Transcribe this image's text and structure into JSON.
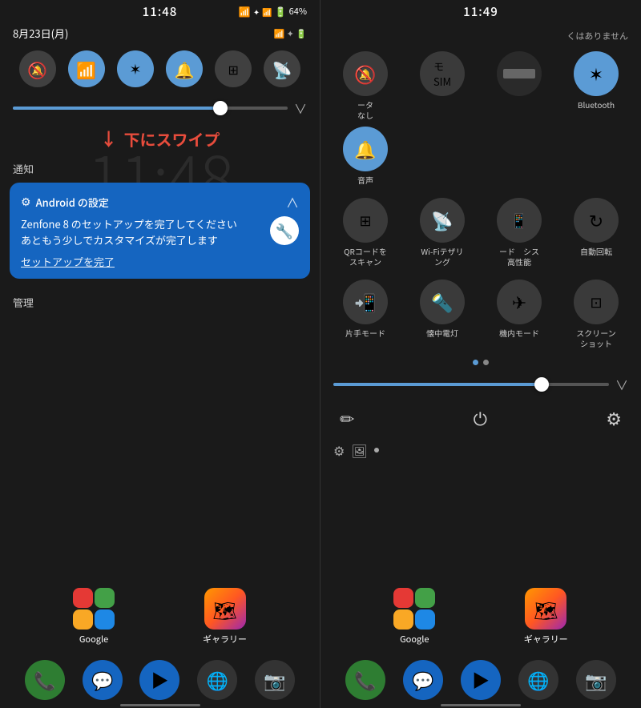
{
  "left_panel": {
    "status_time": "11:48",
    "date": "8月23日(月)",
    "battery": "64%",
    "toggles": [
      {
        "id": "silent",
        "icon": "🔕",
        "active": false
      },
      {
        "id": "wifi",
        "icon": "📶",
        "active": true
      },
      {
        "id": "bluetooth",
        "icon": "🔵",
        "active": true
      },
      {
        "id": "bell",
        "icon": "🔔",
        "active": true
      },
      {
        "id": "qr",
        "icon": "⊞",
        "active": false
      },
      {
        "id": "cast",
        "icon": "📡",
        "active": false
      }
    ],
    "swipe_text": "下にスワイプ",
    "clock_bg": "11:48",
    "notification_label": "通知",
    "notification": {
      "app_name": "Android の設定",
      "title": "Zenfone 8 のセットアップを完了してください\nあともう少しでカスタマイズが完了します",
      "action": "セットアップを完了"
    },
    "management_label": "管理",
    "app_groups": [
      {
        "label": "Google"
      },
      {
        "label": "ギャラリー"
      }
    ],
    "dock_icons": [
      "📞",
      "💬",
      "▶",
      "🌐",
      "📷"
    ]
  },
  "right_panel": {
    "status_time": "11:49",
    "no_network_text": "くはありません",
    "tiles_row1": [
      {
        "id": "silent",
        "icon": "🔕",
        "label": "ータ\nなし",
        "active": false
      },
      {
        "id": "wifi",
        "icon": "📶",
        "label": "モ\nSIM",
        "active": true
      },
      {
        "id": "data",
        "icon": "▬",
        "label": "",
        "active": false
      },
      {
        "id": "bluetooth",
        "icon": "⚡",
        "label": "Bluetooth",
        "active": true
      },
      {
        "id": "sound",
        "icon": "🔔",
        "label": "音声",
        "active": true
      }
    ],
    "tiles_row2": [
      {
        "id": "qr",
        "icon": "⊞",
        "label": "QRコードを\nスキャン",
        "active": false
      },
      {
        "id": "hotspot",
        "icon": "📡",
        "label": "Wi-Fiテザリ\nング",
        "active": false
      },
      {
        "id": "performance",
        "icon": "📱",
        "label": "ード　シス\n高性能",
        "active": false
      },
      {
        "id": "rotate",
        "icon": "🔄",
        "label": "自動回転",
        "active": false
      }
    ],
    "tiles_row3": [
      {
        "id": "onehand",
        "icon": "📲",
        "label": "片手モード",
        "active": false
      },
      {
        "id": "flashlight",
        "icon": "🔦",
        "label": "懐中電灯",
        "active": false
      },
      {
        "id": "airplane",
        "icon": "✈",
        "label": "機内モード",
        "active": false
      },
      {
        "id": "screenshot",
        "icon": "📸",
        "label": "スクリーン\nショット",
        "active": false
      }
    ],
    "page_dots": [
      {
        "active": true
      },
      {
        "active": false
      }
    ],
    "bottom_actions": {
      "edit_icon": "✏",
      "power_icon": "⏻",
      "settings_icon": "⚙"
    },
    "app_groups": [
      {
        "label": "Google"
      },
      {
        "label": "ギャラリー"
      }
    ],
    "dock_icons": [
      "📞",
      "💬",
      "▶",
      "🌐",
      "📷"
    ]
  }
}
